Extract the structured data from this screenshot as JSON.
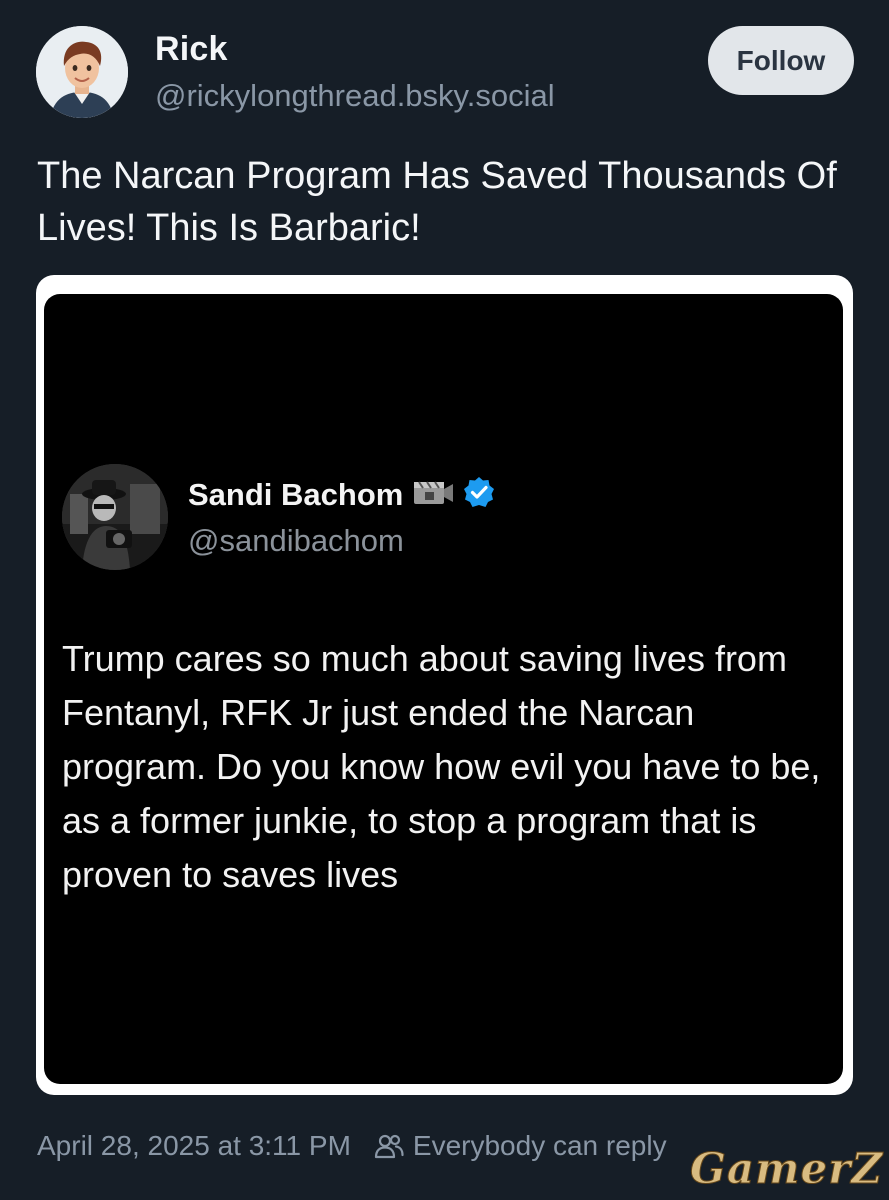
{
  "author": {
    "name": "Rick",
    "handle": "@rickylongthread.bsky.social",
    "follow_label": "Follow"
  },
  "post": {
    "text": "The Narcan Program Has Saved Thousands Of Lives! This Is Barbaric!"
  },
  "quoted": {
    "name": "Sandi Bachom",
    "handle": "@sandibachom",
    "text": "Trump cares so much about saving lives from Fentanyl, RFK Jr just ended the Narcan program. Do you know how evil you have to be, as a former junkie, to stop a program that is proven to saves lives",
    "verified_color": "#1d9bf0"
  },
  "footer": {
    "timestamp": "April 28, 2025 at 3:11 PM",
    "reply_setting": "Everybody can reply"
  },
  "watermark": "GamerZ",
  "colors": {
    "background": "#161e27",
    "muted_text": "#8a97a6",
    "follow_bg": "#e2e6ea"
  }
}
